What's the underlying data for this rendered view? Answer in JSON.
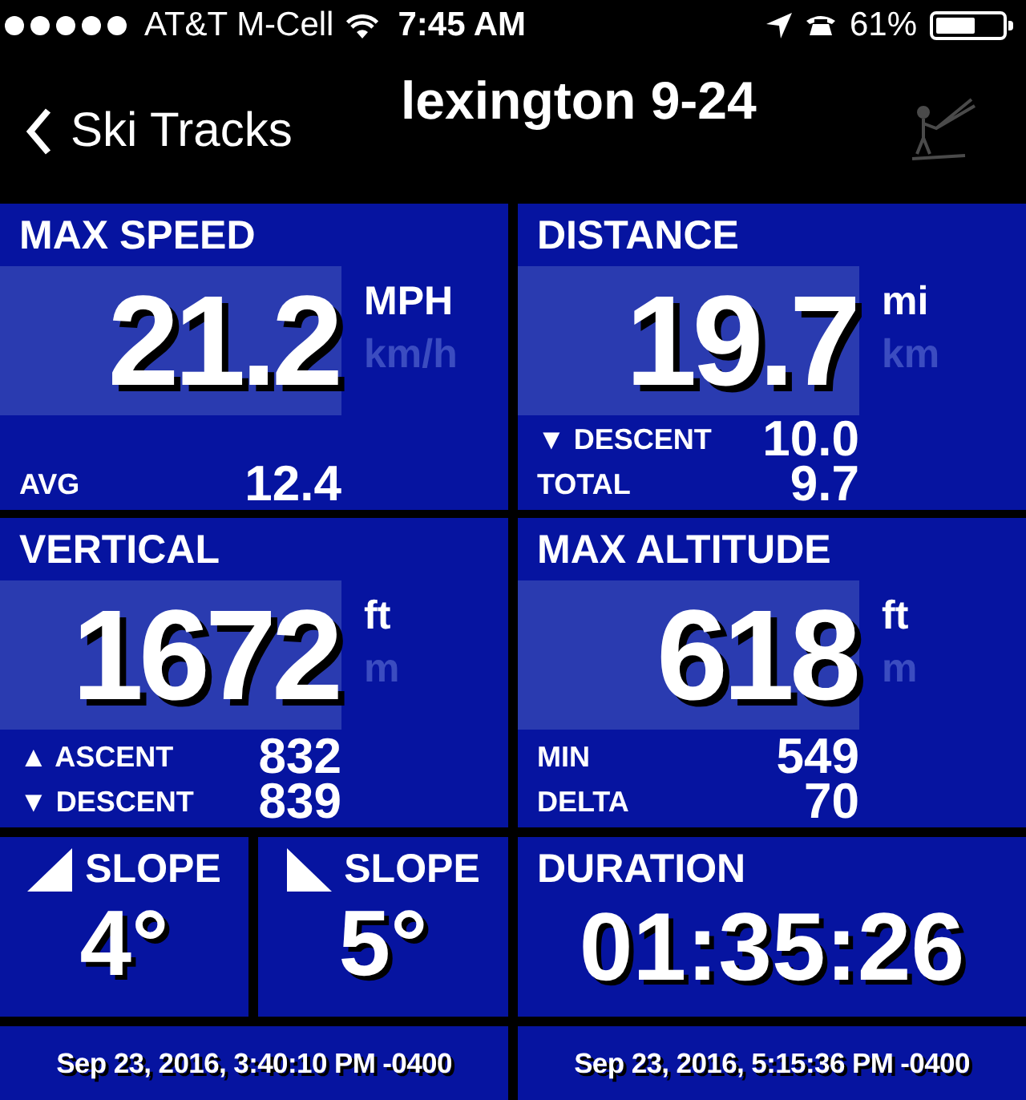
{
  "status_bar": {
    "carrier": "AT&T M-Cell",
    "time": "7:45 AM",
    "battery": "61%"
  },
  "nav": {
    "back": "Ski Tracks",
    "title": "lexington 9-24"
  },
  "panels": [
    {
      "title": "MAX SPEED",
      "value": "21.2",
      "units": [
        {
          "label": "MPH",
          "selected": true
        },
        {
          "label": "km/h",
          "selected": false
        }
      ],
      "rows": [
        {
          "label": "AVG",
          "value": "12.4"
        }
      ]
    },
    {
      "title": "DISTANCE",
      "value": "19.7",
      "units": [
        {
          "label": "mi",
          "selected": true
        },
        {
          "label": "km",
          "selected": false
        }
      ],
      "rows": [
        {
          "label": "▼ DESCENT",
          "value": "10.0"
        },
        {
          "label": "TOTAL",
          "value": "9.7"
        }
      ]
    },
    {
      "title": "VERTICAL",
      "value": "1672",
      "units": [
        {
          "label": "ft",
          "selected": true
        },
        {
          "label": "m",
          "selected": false
        }
      ],
      "rows": [
        {
          "label": "▲ ASCENT",
          "value": "832"
        },
        {
          "label": "▼ DESCENT",
          "value": "839"
        }
      ]
    },
    {
      "title": "MAX ALTITUDE",
      "value": "618",
      "units": [
        {
          "label": "ft",
          "selected": true
        },
        {
          "label": "m",
          "selected": false
        }
      ],
      "rows": [
        {
          "label": "MIN",
          "value": "549"
        },
        {
          "label": "DELTA",
          "value": "70"
        }
      ]
    }
  ],
  "slopes": [
    {
      "kind": "up",
      "label": "SLOPE",
      "value": "4°"
    },
    {
      "kind": "down",
      "label": "SLOPE",
      "value": "5°"
    }
  ],
  "duration": {
    "title": "DURATION",
    "value": "01:35:26"
  },
  "footer": [
    "Sep 23, 2016, 3:40:10 PM -0400",
    "Sep 23, 2016, 5:15:36 PM -0400"
  ]
}
